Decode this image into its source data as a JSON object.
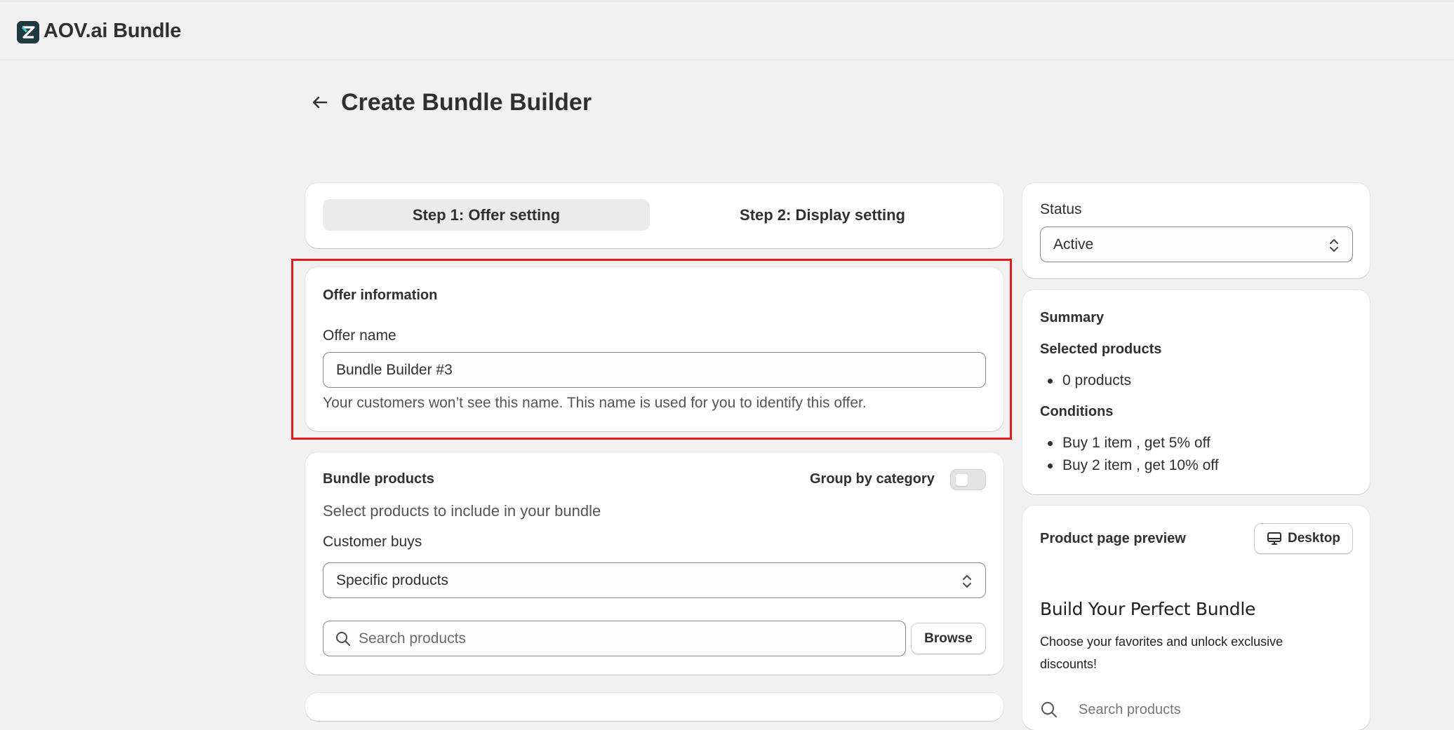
{
  "app": {
    "title": "AOV.ai Bundle"
  },
  "page": {
    "title": "Create Bundle Builder"
  },
  "steps": [
    {
      "label": "Step 1: Offer setting",
      "active": true
    },
    {
      "label": "Step 2: Display setting",
      "active": false
    }
  ],
  "offer": {
    "section_title": "Offer information",
    "name_label": "Offer name",
    "name_value": "Bundle Builder #3",
    "help_text": "Your customers won’t see this name. This name is used for you to identify this offer."
  },
  "bundle": {
    "section_title": "Bundle products",
    "group_label": "Group by category",
    "group_enabled": false,
    "subtitle": "Select products to include in your bundle",
    "customer_buys_label": "Customer buys",
    "customer_buys_value": "Specific products",
    "search_placeholder": "Search products",
    "browse_label": "Browse"
  },
  "status": {
    "label": "Status",
    "value": "Active"
  },
  "summary": {
    "title": "Summary",
    "selected_products_title": "Selected products",
    "selected_products": [
      "0 products"
    ],
    "conditions_title": "Conditions",
    "conditions": [
      "Buy 1 item , get 5% off",
      "Buy 2 item , get 10% off"
    ]
  },
  "preview": {
    "title": "Product page preview",
    "device_label": "Desktop",
    "heading": "Build Your Perfect Bundle",
    "description": "Choose your favorites and unlock exclusive discounts!",
    "search_placeholder": "Search products"
  },
  "colors": {
    "highlight": "#e31b1b",
    "background": "#f1f1f1",
    "logo": "#1d3a40"
  }
}
